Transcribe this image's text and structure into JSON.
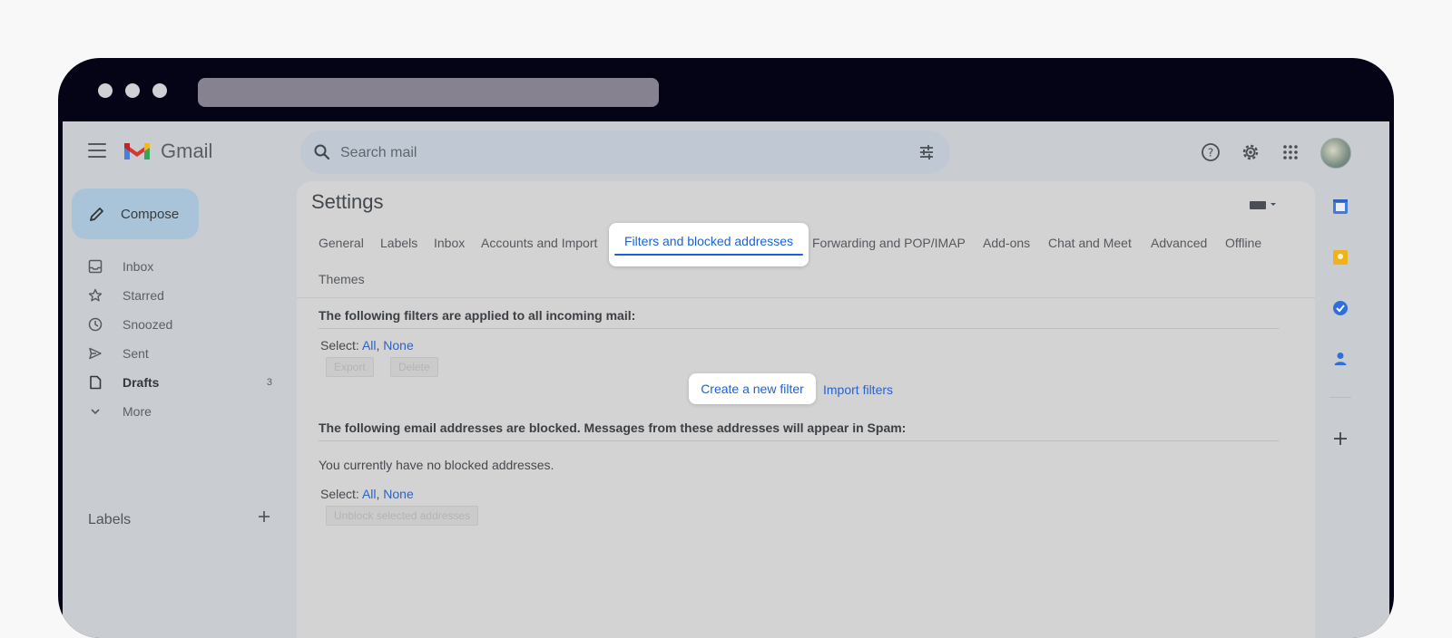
{
  "app": {
    "name": "Gmail"
  },
  "search": {
    "placeholder": "Search mail"
  },
  "compose": {
    "label": "Compose"
  },
  "nav": [
    {
      "label": "Inbox",
      "icon": "inbox-icon",
      "count": "",
      "bold": false
    },
    {
      "label": "Starred",
      "icon": "star-icon",
      "count": "",
      "bold": false
    },
    {
      "label": "Snoozed",
      "icon": "clock-icon",
      "count": "",
      "bold": false
    },
    {
      "label": "Sent",
      "icon": "send-icon",
      "count": "",
      "bold": false
    },
    {
      "label": "Drafts",
      "icon": "draft-icon",
      "count": "3",
      "bold": true
    },
    {
      "label": "More",
      "icon": "chevron-down-icon",
      "count": "",
      "bold": false
    }
  ],
  "labels": {
    "title": "Labels"
  },
  "settings": {
    "title": "Settings",
    "tabs": [
      "General",
      "Labels",
      "Inbox",
      "Accounts and Import",
      "Filters and blocked addresses",
      "Forwarding and POP/IMAP",
      "Add-ons",
      "Chat and Meet",
      "Advanced",
      "Offline",
      "Themes"
    ],
    "active_tab": "Filters and blocked addresses"
  },
  "filters": {
    "heading": "The following filters are applied to all incoming mail:",
    "select_label": "Select:",
    "select_all": "All",
    "select_none": "None",
    "export_label": "Export",
    "delete_label": "Delete",
    "create_label": "Create a new filter",
    "import_label": "Import filters"
  },
  "blocked": {
    "heading": "The following email addresses are blocked. Messages from these addresses will appear in Spam:",
    "empty_text": "You currently have no blocked addresses.",
    "select_label": "Select:",
    "select_all": "All",
    "select_none": "None",
    "unblock_label": "Unblock selected addresses"
  },
  "colors": {
    "accent": "#1a63d6",
    "link": "#2b63c8",
    "compose_bg": "#a9c4d8",
    "frame": "#050316"
  }
}
